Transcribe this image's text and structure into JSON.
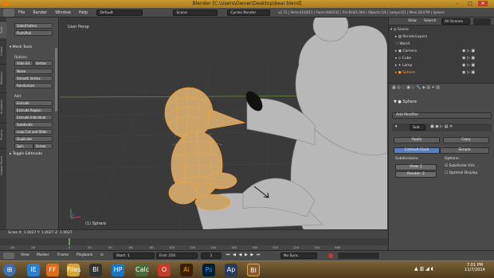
{
  "window": {
    "title": "Blender [C:\\Users\\Owner\\Desktop\\bear.blend]",
    "min": "–",
    "max": "□",
    "close": "✕"
  },
  "menubar": {
    "items": [
      "File",
      "Render",
      "Window",
      "Help"
    ],
    "layout": "Default",
    "scene": "Scene",
    "engine": "Cycles Render",
    "stats": "v2.72 | Verts:416/615 | Faces:406/532 | Tris:810/1,064 | Objects:1/4 | Lamps:0/1 | Mem:28.07M | Sphere"
  },
  "toolshelf": {
    "tabs": [
      "Tools",
      "Create",
      "Relations",
      "Animation",
      "Physics",
      "Grease Pencil"
    ],
    "top_buttons": [
      "Slide/Flatten",
      "Push/Pull"
    ],
    "mesh_tools_header": "Mesh Tools",
    "options_label": "Options:",
    "buttons1": [
      "Slide Ed",
      "Vertex",
      "Noise",
      "Smooth Vertex",
      "Randomize"
    ],
    "add_label": "Add:",
    "buttons2": [
      "Extrude",
      "Extrude Region",
      "Extrude Individual",
      "Subdivide",
      "Loop Cut and Slide",
      "Duplicate",
      "Spin",
      "Screw"
    ],
    "toggle_label": "Toggle Editmode"
  },
  "viewport": {
    "label": "User Persp",
    "object_label": "(1) Sphere"
  },
  "outliner": {
    "view": "View",
    "search": "Search",
    "filter": "All Scenes",
    "items": [
      "Scene",
      "RenderLayers",
      "World",
      "Camera",
      "Cube",
      "Lamp",
      "Sphere"
    ]
  },
  "properties": {
    "object_name": "Sphere",
    "add_modifier": "Add Modifier",
    "modifier_name": "Sub",
    "apply": "Apply",
    "copy": "Copy",
    "catmull": "Catmull-Clark",
    "simple": "Simple",
    "subdivisions": "Subdivisions:",
    "options": "Options:",
    "view_field": "View: 1",
    "render_field": "Render: 2",
    "subdivide_uvs": "Subdivide UVs",
    "optimal_display": "Optimal Display"
  },
  "timeline": {
    "scale_text": "Scale X: 1.0027   Y: 1.0027   Z: 1.0027",
    "ticks": [
      "-40",
      "-20",
      "0",
      "20",
      "40",
      "60",
      "80",
      "100",
      "120",
      "140",
      "160",
      "180",
      "200",
      "220",
      "240",
      "260"
    ],
    "menus": [
      "View",
      "Marker",
      "Frame",
      "Playback"
    ],
    "start": "Start:",
    "start_val": "1",
    "end": "End:",
    "end_val": "250",
    "current": "1",
    "sync": "No Sync"
  },
  "taskbar": {
    "time": "7:01 PM",
    "date": "11/7/2014",
    "apps": [
      "IE",
      "FF",
      "Files",
      "Bl",
      "HP",
      "Calc",
      "O",
      "Ai",
      "Ps",
      "Ap",
      "Bl"
    ]
  },
  "colors": {
    "accent": "#ffa033",
    "selected": "#5680c2",
    "viewport_bg": "#3a3a3a"
  }
}
